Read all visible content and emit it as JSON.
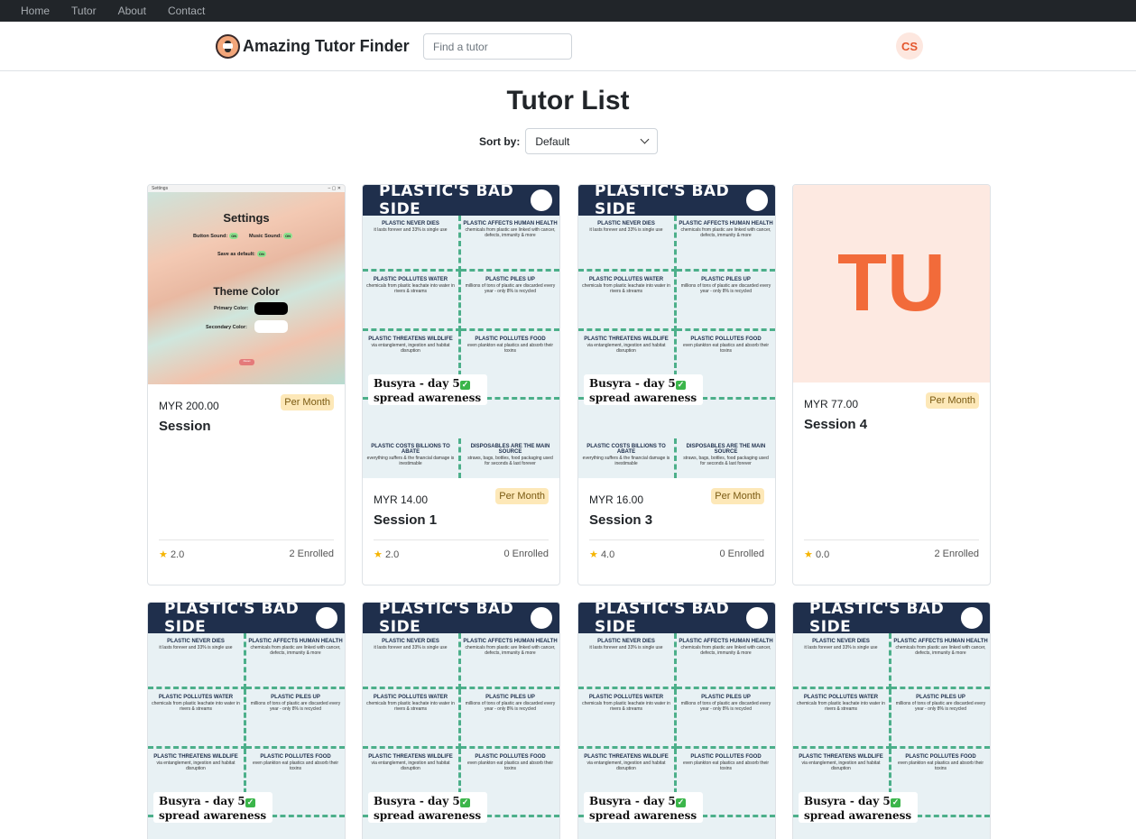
{
  "topnav": {
    "items": [
      "Home",
      "Tutor",
      "About",
      "Contact"
    ]
  },
  "header": {
    "brand": "Amazing Tutor Finder",
    "search_placeholder": "Find a tutor",
    "avatar_initials": "CS"
  },
  "main": {
    "title": "Tutor List",
    "sort_label": "Sort by:",
    "sort_value": "Default"
  },
  "settings_thumb": {
    "title": "Settings",
    "button_sound": "Button Sound:",
    "music_sound": "Music Sound:",
    "save_default": "Save as default:",
    "on": "ON",
    "theme_color": "Theme Color",
    "primary": "Primary Color:",
    "secondary": "Secondary Color:",
    "reset": "Reset",
    "window_title": "Settings"
  },
  "plastic_thumb": {
    "header": "PLASTIC'S BAD SIDE",
    "cells": [
      {
        "h": "PLASTIC NEVER DIES",
        "d": "it lasts forever and 33% is single use"
      },
      {
        "h": "PLASTIC AFFECTS HUMAN HEALTH",
        "d": "chemicals from plastic are linked with cancer, defects, immunity & more"
      },
      {
        "h": "PLASTIC POLLUTES WATER",
        "d": "chemicals from plastic leachate into water in rivers & streams"
      },
      {
        "h": "PLASTIC PILES UP",
        "d": "millions of tons of plastic are discarded every year - only 8% is recycled"
      },
      {
        "h": "PLASTIC THREATENS WILDLIFE",
        "d": "via entanglement, ingestion and habitat disruption"
      },
      {
        "h": "PLASTIC POLLUTES FOOD",
        "d": "even plankton eat plastics and absorb their toxins"
      },
      {
        "h": "PLASTIC COSTS BILLIONS TO ABATE",
        "d": "everything suffers & the financial damage is inestimable"
      },
      {
        "h": "DISPOSABLES ARE THE MAIN SOURCE",
        "d": "straws, bags, bottles, food packaging used for seconds & last forever"
      }
    ],
    "banner_line1": "Busyra - day 5",
    "banner_line2": "spread awareness",
    "check": "✓"
  },
  "tu_thumb": {
    "initials": "TU"
  },
  "cards": [
    {
      "price": "MYR 200.00",
      "period": "Per Month",
      "title": "Session",
      "rating": "2.0",
      "enrolled": "2 Enrolled"
    },
    {
      "price": "MYR 14.00",
      "period": "Per Month",
      "title": "Session 1",
      "rating": "2.0",
      "enrolled": "0 Enrolled"
    },
    {
      "price": "MYR 16.00",
      "period": "Per Month",
      "title": "Session 3",
      "rating": "4.0",
      "enrolled": "0 Enrolled"
    },
    {
      "price": "MYR 77.00",
      "period": "Per Month",
      "title": "Session 4",
      "rating": "0.0",
      "enrolled": "2 Enrolled"
    }
  ],
  "colors": {
    "navbar": "#212529",
    "accent": "#f26b3a",
    "badge_bg": "#fde8b8",
    "star": "#f5b400"
  },
  "icons": {
    "star": "star-icon",
    "chevron": "chevron-down-icon",
    "logo": "brand-logo-icon"
  }
}
